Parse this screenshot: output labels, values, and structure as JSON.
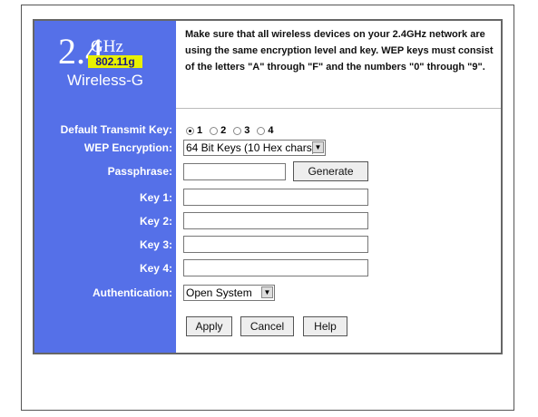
{
  "logo": {
    "band": "2.4",
    "unit": "GHz",
    "standard": "802.11g",
    "product": "Wireless-G"
  },
  "intro": "Make sure that all wireless devices on your 2.4GHz network are using the same encryption level and key. WEP keys must consist of the letters \"A\" through \"F\" and the numbers \"0\" through \"9\".",
  "labels": {
    "default_transmit_key": "Default Transmit Key:",
    "wep_encryption": "WEP Encryption:",
    "passphrase": "Passphrase:",
    "key1": "Key 1:",
    "key2": "Key 2:",
    "key3": "Key 3:",
    "key4": "Key 4:",
    "authentication": "Authentication:"
  },
  "default_key_options": [
    "1",
    "2",
    "3",
    "4"
  ],
  "default_key_selected": "1",
  "wep_encryption_value": "64 Bit Keys (10 Hex chars)",
  "passphrase_value": "",
  "keys": [
    "",
    "",
    "",
    ""
  ],
  "authentication_value": "Open System",
  "buttons": {
    "generate": "Generate",
    "apply": "Apply",
    "cancel": "Cancel",
    "help": "Help"
  },
  "colors": {
    "sidebar": "#5570e8",
    "badge": "#e8f000"
  }
}
